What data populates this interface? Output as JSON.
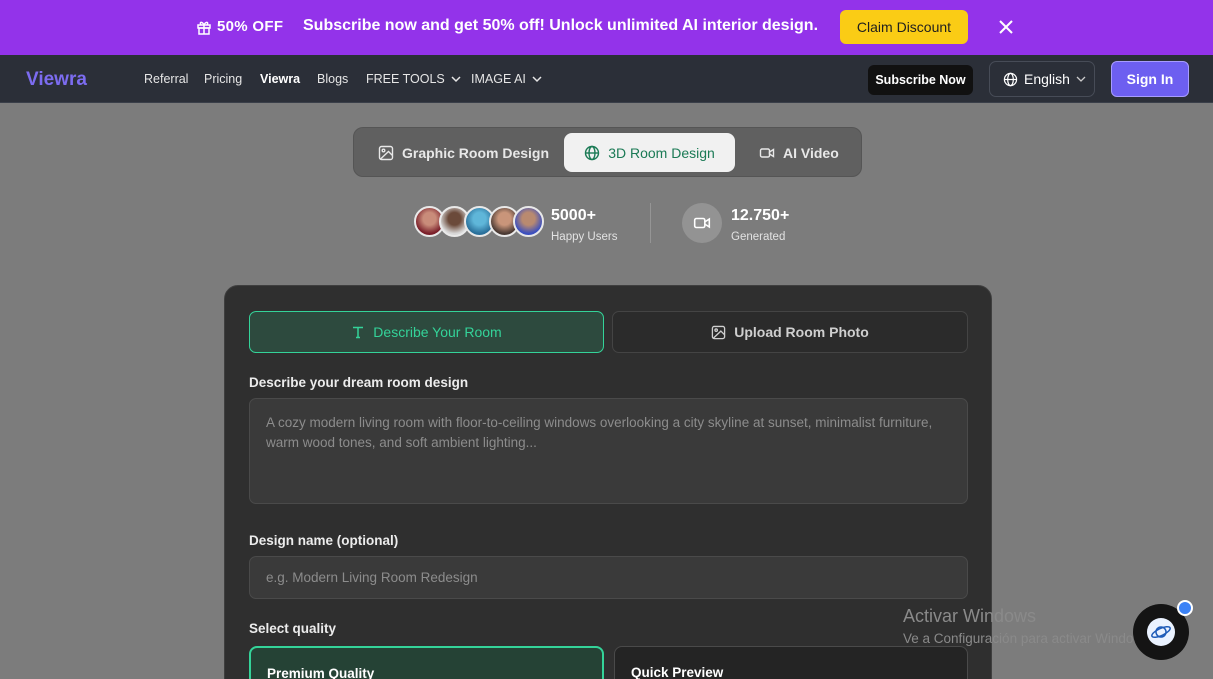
{
  "promo": {
    "discount": "50% OFF",
    "message": "Subscribe now and get 50% off! Unlock unlimited AI interior design.",
    "cta": "Claim Discount"
  },
  "nav": {
    "brand": "Viewra",
    "links": [
      "Referral",
      "Pricing",
      "Viewra",
      "Blogs",
      "FREE TOOLS",
      "IMAGE AI"
    ],
    "subscribe": "Subscribe Now",
    "language": "English",
    "signin": "Sign In"
  },
  "modes": [
    {
      "label": "Graphic Room Design",
      "icon": "image-icon"
    },
    {
      "label": "3D Room Design",
      "icon": "globe-icon"
    },
    {
      "label": "AI Video",
      "icon": "video-icon"
    }
  ],
  "stats": {
    "users_value": "5000+",
    "users_label": "Happy Users",
    "generated_value": "12.750+",
    "generated_label": "Generated"
  },
  "card": {
    "tab_describe": "Describe Your Room",
    "tab_upload": "Upload Room Photo",
    "describe_label": "Describe your dream room design",
    "describe_placeholder": "A cozy modern living room with floor-to-ceiling windows overlooking a city skyline at sunset, minimalist furniture, warm wood tones, and soft ambient lighting...",
    "name_label": "Design name (optional)",
    "name_placeholder": "e.g. Modern Living Room Redesign",
    "quality_label": "Select quality",
    "quality_premium": "Premium Quality",
    "quality_quick": "Quick Preview"
  },
  "watermark": {
    "title": "Activar Windows",
    "subtitle": "Ve a Configuración para activar Windows."
  },
  "colors": {
    "promo_bg": "#9333ea",
    "accent_green": "#34d399",
    "signin_bg": "#6d5ff0",
    "claim_bg": "#facc15"
  }
}
